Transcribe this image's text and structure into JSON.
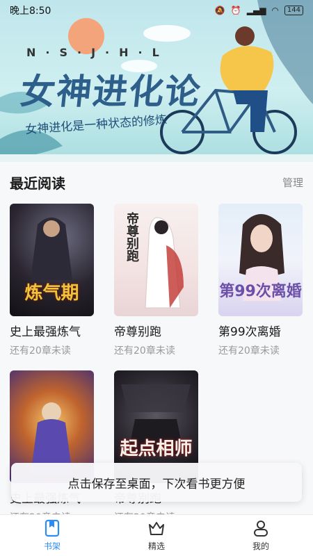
{
  "status_bar": {
    "time": "晚上8:50",
    "battery": "144"
  },
  "banner": {
    "letters": "N·S·J·H·L",
    "title": "女神进化论",
    "subtitle": "女神进化是一种状态的修炼"
  },
  "recent": {
    "title": "最近阅读",
    "manage_label": "管理",
    "books": [
      {
        "title": "史上最强炼气",
        "status": "还有20章未读",
        "cover_text": "炼气期"
      },
      {
        "title": "帝尊别跑",
        "status": "还有20章未读",
        "cover_text": "帝尊别跑"
      },
      {
        "title": "第99次离婚",
        "status": "还有20章未读",
        "cover_text": "第99次离婚"
      },
      {
        "title": "史上最强炼气",
        "status": "还有20章未读",
        "cover_text": ""
      },
      {
        "title": "帝尊别跑",
        "status": "还有20章未读",
        "cover_text": "起点相师"
      }
    ]
  },
  "toast": {
    "text": "点击保存至桌面，下次看书更方便"
  },
  "nav": {
    "items": [
      {
        "label": "书架",
        "icon": "bookmark-icon",
        "active": true
      },
      {
        "label": "精选",
        "icon": "crown-icon",
        "active": false
      },
      {
        "label": "我的",
        "icon": "person-icon",
        "active": false
      }
    ],
    "active_color": "#2b8cf3"
  }
}
